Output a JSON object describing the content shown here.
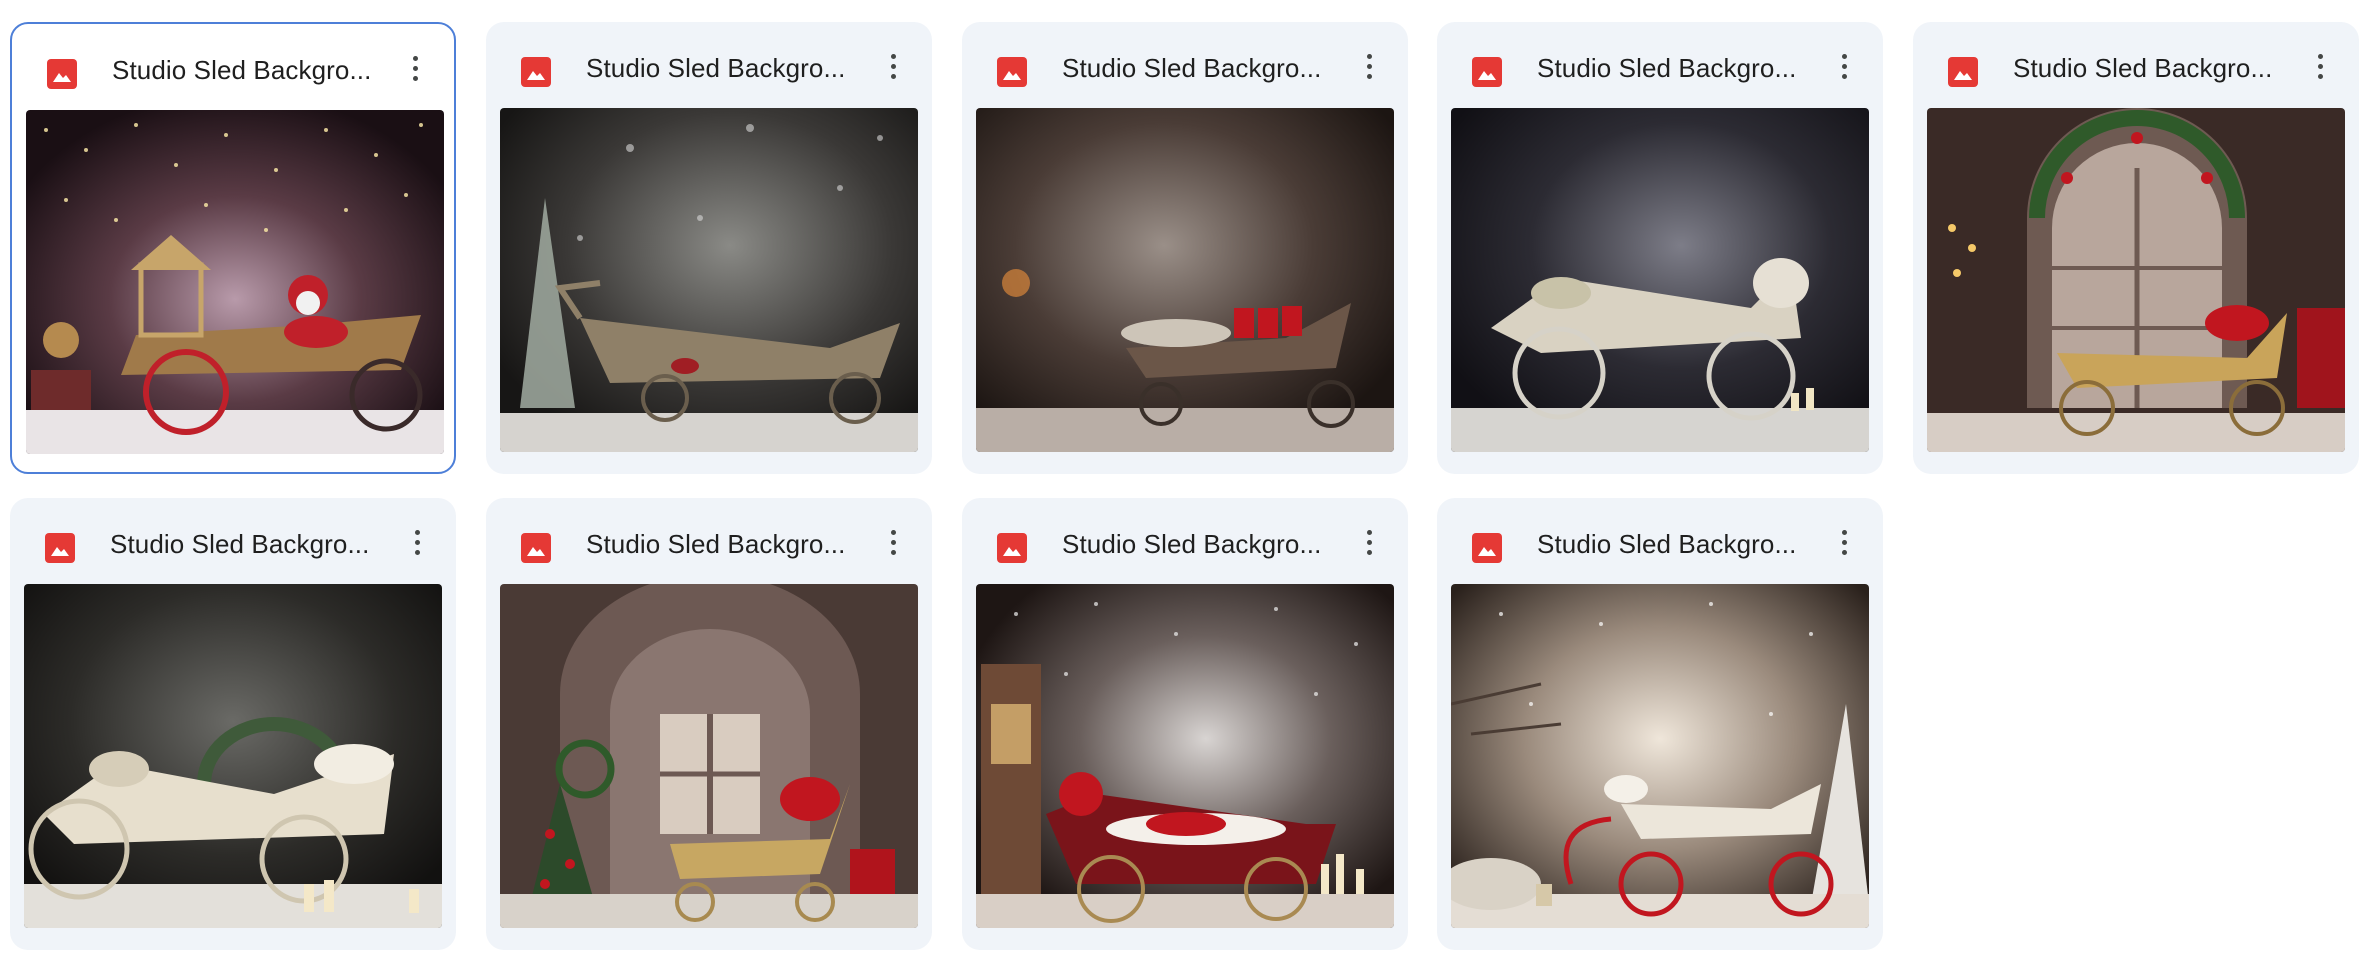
{
  "files": [
    {
      "name": "Studio Sled Backgro...",
      "type": "image",
      "thumbnail": "sled-backdrop-1"
    },
    {
      "name": "Studio Sled Backgro...",
      "type": "image",
      "thumbnail": "sled-backdrop-2"
    },
    {
      "name": "Studio Sled Backgro...",
      "type": "image",
      "thumbnail": "sled-backdrop-3"
    },
    {
      "name": "Studio Sled Backgro...",
      "type": "image",
      "thumbnail": "sled-backdrop-4"
    },
    {
      "name": "Studio Sled Backgro...",
      "type": "image",
      "thumbnail": "sled-backdrop-5"
    },
    {
      "name": "Studio Sled Backgro...",
      "type": "image",
      "thumbnail": "sled-backdrop-6"
    },
    {
      "name": "Studio Sled Backgro...",
      "type": "image",
      "thumbnail": "sled-backdrop-7"
    },
    {
      "name": "Studio Sled Backgro...",
      "type": "image",
      "thumbnail": "sled-backdrop-8"
    },
    {
      "name": "Studio Sled Backgro...",
      "type": "image",
      "thumbnail": "sled-backdrop-9"
    }
  ],
  "selected_index": 0,
  "icons": {
    "file_type": "image-icon",
    "menu": "more-vert-icon"
  },
  "colors": {
    "card_bg": "#f0f4f9",
    "selected_border": "#4d7fd8",
    "image_icon": "#e53935"
  }
}
